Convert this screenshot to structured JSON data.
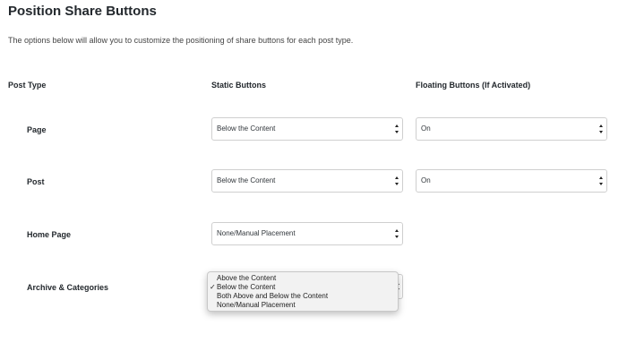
{
  "header": {
    "title": "Position Share Buttons",
    "description": "The options below will allow you to customize the positioning of share buttons for each post type."
  },
  "columns": {
    "post_type": "Post Type",
    "static_buttons": "Static Buttons",
    "floating_buttons": "Floating Buttons (If Activated)"
  },
  "rows": [
    {
      "label": "Page",
      "static_value": "Below the Content",
      "floating_value": "On"
    },
    {
      "label": "Post",
      "static_value": "Below the Content",
      "floating_value": "On"
    },
    {
      "label": "Home Page",
      "static_value": "None/Manual Placement"
    },
    {
      "label": "Archive & Categories",
      "static_value": "Below the Content"
    }
  ],
  "open_dropdown": {
    "options": [
      {
        "label": "Above the Content",
        "checked": false
      },
      {
        "label": "Below the Content",
        "checked": true
      },
      {
        "label": "Both Above and Below the Content",
        "checked": false
      },
      {
        "label": "None/Manual Placement",
        "checked": false
      }
    ],
    "check_glyph": "✓"
  },
  "icons": {
    "select_arrows": "updown-chevron-icon"
  }
}
